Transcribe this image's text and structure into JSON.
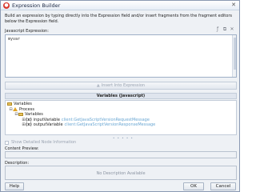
{
  "window": {
    "title": "Expression Builder",
    "intro": "Build an expression by typing directly into the Expression field and/or insert fragments from the fragment editors below the Expression field."
  },
  "expression": {
    "label": "Javascript Expression:",
    "value": "myvar"
  },
  "insert_button": {
    "label": "Insert Into Expression"
  },
  "variables": {
    "header": "Variables (Javascript)",
    "tree": [
      {
        "label": "Variables",
        "expander": "",
        "icon": "folder-icon"
      },
      {
        "label": "Process",
        "expander": "⊟",
        "icon": "warning-icon"
      },
      {
        "label": "Variables",
        "expander": "⊟",
        "icon": "folder-icon"
      },
      {
        "label": "inputVariable",
        "expander": "⊞",
        "icon": "x-variable-icon",
        "type": "client:GetJavaScriptVersionRequestMessage"
      },
      {
        "label": "outputVariable",
        "expander": "⊞",
        "icon": "x-variable-icon",
        "type": "client:GetJavaScriptVersionResponseMessage"
      }
    ]
  },
  "show_detail": {
    "label": "Show Detailed Node Information",
    "checked": false
  },
  "content_preview": {
    "label": "Content Preview:"
  },
  "description": {
    "label": "Description:",
    "placeholder": "No Description Available"
  },
  "buttons": {
    "help": "Help",
    "ok": "OK",
    "cancel": "Cancel"
  },
  "colors": {
    "accent": "#6aa7d3",
    "header_bg": "#dfe5ee",
    "window_bg": "#eef1f5"
  }
}
